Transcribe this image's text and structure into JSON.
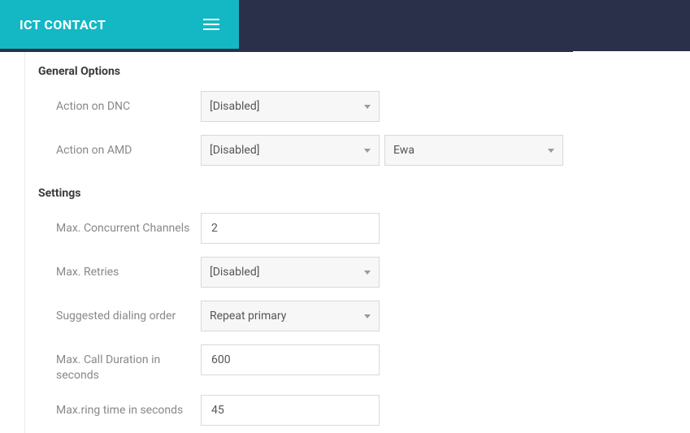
{
  "header": {
    "brand": "ICT CONTACT"
  },
  "sections": {
    "general": {
      "title": "General Options",
      "action_dnc": {
        "label": "Action on DNC",
        "value": "[Disabled]"
      },
      "action_amd": {
        "label": "Action on AMD",
        "value": "[Disabled]",
        "secondary": "Ewa"
      }
    },
    "settings": {
      "title": "Settings",
      "max_channels": {
        "label": "Max. Concurrent Channels",
        "value": "2"
      },
      "max_retries": {
        "label": "Max. Retries",
        "value": "[Disabled]"
      },
      "dialing_order": {
        "label": "Suggested dialing order",
        "value": "Repeat primary"
      },
      "max_call_duration": {
        "label": "Max. Call Duration in seconds",
        "value": "600"
      },
      "max_ring_time": {
        "label": "Max.ring time in seconds",
        "value": "45"
      }
    }
  },
  "colors": {
    "accent": "#13b8c4",
    "dark": "#2a2f4a",
    "logo": "#2a6cb8"
  }
}
